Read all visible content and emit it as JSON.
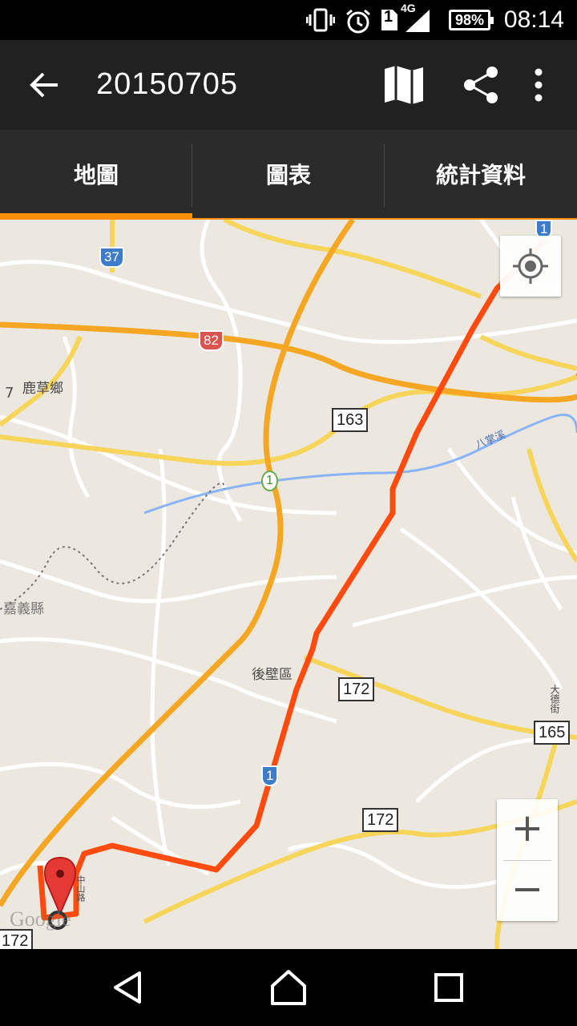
{
  "status_bar": {
    "time": "08:14",
    "battery": "98%",
    "network": "4G",
    "sim": "1",
    "icons": [
      "vibrate-icon",
      "alarm-icon",
      "sim-icon",
      "signal-icon",
      "battery-icon"
    ]
  },
  "app_bar": {
    "title": "20150705",
    "icons": [
      "back-arrow-icon",
      "map-icon",
      "share-icon",
      "overflow-menu-icon"
    ]
  },
  "tabs": [
    {
      "label": "地圖",
      "selected": true
    },
    {
      "label": "圖表",
      "selected": false
    },
    {
      "label": "統計資料",
      "selected": false
    }
  ],
  "colors": {
    "accent": "#ff8f00",
    "route": "#ff4b0f",
    "app_bar": "#212121",
    "tab_bar": "#2b2b2b",
    "highway": "#f5a623",
    "road_yellow": "#f7d55a",
    "map_bg": "#ece8df"
  },
  "map": {
    "place_labels": {
      "lucao": "鹿草鄉",
      "chiayi_county": "嘉義縣",
      "houbi": "後壁區",
      "bazhang_river": "八掌溪",
      "dade_street": "大德街",
      "zhongshan_road": "中山路",
      "edge_number": "7"
    },
    "road_shields": {
      "r37": "37",
      "r82": "82",
      "r163": "163",
      "r1_top": "1",
      "r1_mid": "1",
      "r1_flower": "1",
      "r172_a": "172",
      "r172_b": "172",
      "r172_c": "172",
      "r165": "165"
    },
    "zoom_in_label": "+",
    "zoom_out_label": "−",
    "attribution": "Google"
  },
  "nav_bar": {
    "icons": [
      "back-triangle-icon",
      "home-icon",
      "recents-icon"
    ]
  }
}
